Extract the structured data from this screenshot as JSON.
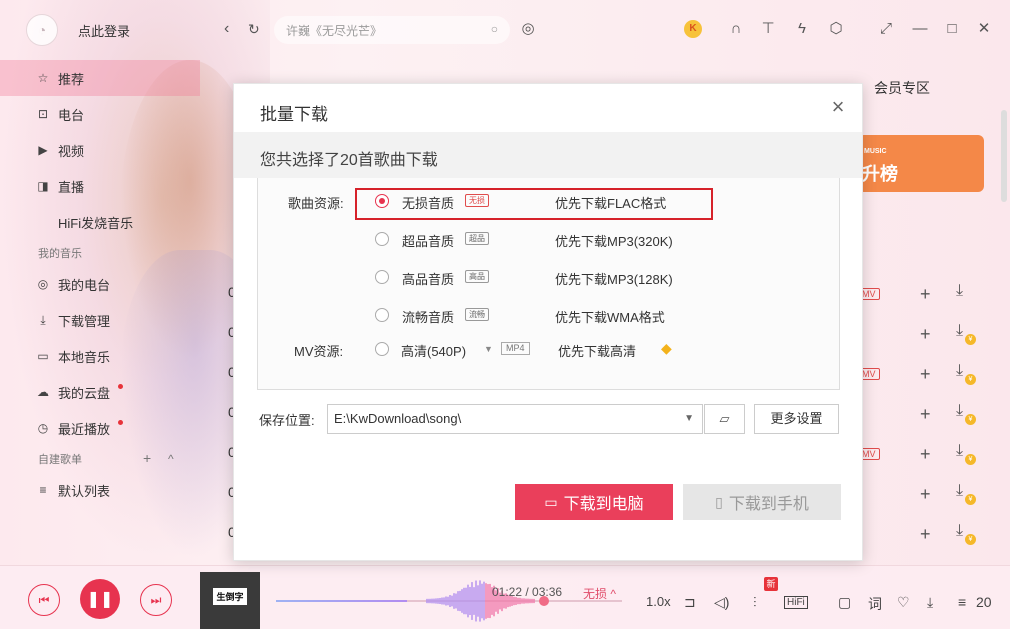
{
  "user": {
    "login_label": "点此登录"
  },
  "sidebar": {
    "items": [
      {
        "label": "推荐",
        "icon": "star-icon",
        "glyph": "☆",
        "active": true
      },
      {
        "label": "电台",
        "icon": "radio-icon",
        "glyph": "⊡"
      },
      {
        "label": "视频",
        "icon": "video-icon",
        "glyph": "▶"
      },
      {
        "label": "直播",
        "icon": "live-icon",
        "glyph": "◨"
      },
      {
        "label": "HiFi发烧音乐",
        "icon": "",
        "glyph": ""
      }
    ],
    "my_music_title": "我的音乐",
    "my_items": [
      {
        "label": "我的电台",
        "icon": "my-radio-icon",
        "glyph": "◎"
      },
      {
        "label": "下载管理",
        "icon": "download-icon",
        "glyph": "⤓"
      },
      {
        "label": "本地音乐",
        "icon": "local-music-icon",
        "glyph": "▭"
      },
      {
        "label": "我的云盘",
        "icon": "cloud-icon",
        "glyph": "☁",
        "dot": true
      },
      {
        "label": "最近播放",
        "icon": "recent-icon",
        "glyph": "◷",
        "dot": true
      }
    ],
    "playlist_title": "自建歌单",
    "playlist_items": [
      {
        "label": "默认列表",
        "icon": "playlist-icon",
        "glyph": "≡"
      }
    ]
  },
  "topbar": {
    "search_placeholder": "许巍《无尽光芒》"
  },
  "tabs": {
    "member": "会员专区"
  },
  "banner": {
    "small": "MUSIC",
    "big": "升榜"
  },
  "player": {
    "time": "01:22 / 03:36",
    "quality": "无损 ^",
    "speed": "1.0x",
    "lyrics": "词",
    "count": "20",
    "new_tag": "新",
    "hifi": "HiFi",
    "cover_text": "生倒字",
    "progress": 0.38
  },
  "modal": {
    "title": "批量下载",
    "selected_text": "您共选择了20首歌曲下载",
    "song_source_label": "歌曲资源:",
    "qualities": [
      {
        "name": "无损音质",
        "badge": "无损",
        "desc": "优先下载FLAC格式",
        "checked": true
      },
      {
        "name": "超品音质",
        "badge": "超品",
        "desc": "优先下载MP3(320K)",
        "checked": false
      },
      {
        "name": "高品音质",
        "badge": "高品",
        "desc": "优先下载MP3(128K)",
        "checked": false
      },
      {
        "name": "流畅音质",
        "badge": "流畅",
        "desc": "优先下载WMA格式",
        "checked": false
      }
    ],
    "mv_label": "MV资源:",
    "mv_option": "高清(540P)",
    "mv_format": "MP4",
    "mv_desc": "优先下载高清",
    "save_label": "保存位置:",
    "save_path": "E:\\KwDownload\\song\\",
    "more_settings": "更多设置",
    "download_pc": "下载到电脑",
    "download_phone": "下载到手机"
  },
  "background_rows": [
    {
      "num": "0",
      "mv": "MV",
      "coin": false
    },
    {
      "num": "0",
      "mv": "",
      "coin": true
    },
    {
      "num": "0",
      "mv": "MV",
      "coin": true
    },
    {
      "num": "0",
      "mv": "",
      "coin": true
    },
    {
      "num": "0",
      "mv": "MV",
      "coin": true
    },
    {
      "num": "0",
      "mv": "",
      "coin": true
    },
    {
      "num": "0",
      "mv": "",
      "coin": true
    }
  ],
  "colors": {
    "accent": "#ea3f5b",
    "highlight_box": "#d6222a"
  }
}
